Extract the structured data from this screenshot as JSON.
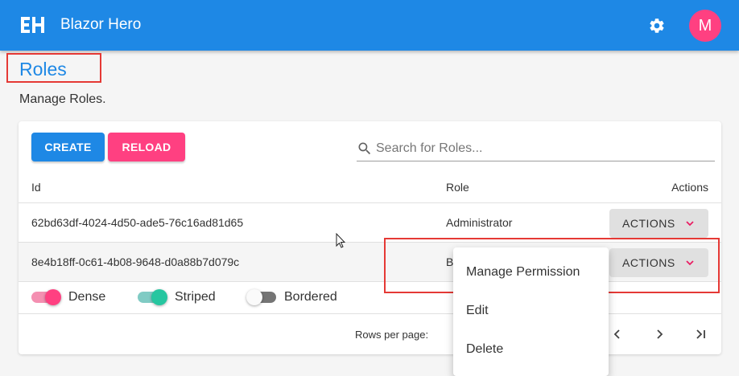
{
  "app": {
    "logo_text": "EH",
    "title": "Blazor Hero",
    "avatar_initial": "M",
    "brand_color": "#1e88e5",
    "accent_color": "#ff4081",
    "settings_icon": "gear-icon"
  },
  "page": {
    "title": "Roles",
    "subtitle": "Manage Roles."
  },
  "toolbar": {
    "create_label": "CREATE",
    "reload_label": "RELOAD",
    "search_placeholder": "Search for Roles...",
    "search_icon": "search-icon"
  },
  "table": {
    "columns": [
      "Id",
      "Role",
      "Actions"
    ],
    "rows": [
      {
        "id": "62bd63df-4024-4d50-ade5-76c16ad81d65",
        "role": "Administrator",
        "action_label": "ACTIONS"
      },
      {
        "id": "8e4b18ff-0c61-4b08-9648-d0a88b7d079c",
        "role": "B",
        "action_label": "ACTIONS"
      }
    ]
  },
  "toggles": [
    {
      "label": "Dense",
      "on": true,
      "color": "#ff4081"
    },
    {
      "label": "Striped",
      "on": true,
      "color": "#26c6a0"
    },
    {
      "label": "Bordered",
      "on": false,
      "color": "#757575"
    }
  ],
  "pagination": {
    "rows_per_page_label": "Rows per page:",
    "prev_icon": "chevron-left-icon",
    "next_icon": "chevron-right-icon",
    "last_icon": "last-page-icon"
  },
  "actions_menu": {
    "items": [
      "Manage Permission",
      "Edit",
      "Delete"
    ]
  },
  "highlight_color": "#e53935"
}
